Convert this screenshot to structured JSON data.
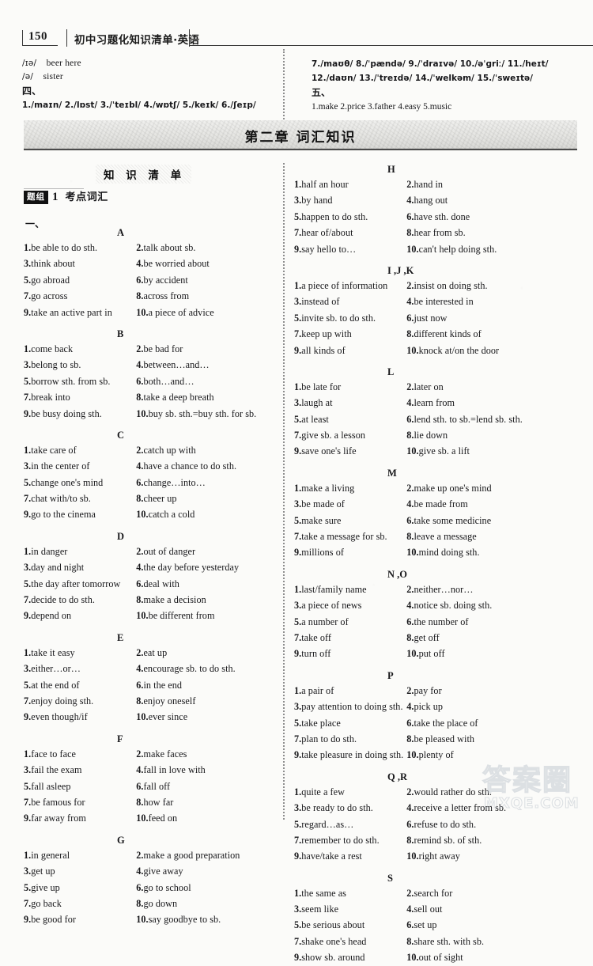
{
  "header": {
    "page_number": "150",
    "book_title": "初中习题化知识清单·英语"
  },
  "top_answers": {
    "left": {
      "ipa_lines": [
        {
          "symbol": "/ɪə/",
          "words": "beer   here"
        },
        {
          "symbol": "/ə/",
          "words": "sister"
        }
      ],
      "section_label": "四、",
      "answers": "1./maɪn/   2./lɒst/   3./ˈteɪbl/   4./wɒtʃ/   5./keɪk/   6./ʃeɪp/"
    },
    "right": {
      "line1": "7./maʊθ/    8./ˈpændə/    9./ˈdraɪvə/    10./əˈɡriː/    11./heɪt/",
      "line2": "12./daʊn/    13./ˈtreɪdə/    14./ˈwelkəm/    15./ˈsweɪtə/",
      "section_label": "五、",
      "answers": "1.make   2.price   3.father   4.easy   5.music"
    }
  },
  "chapter_banner": "第二章  词汇知识",
  "knowledge_list_title": "知 识 清 单",
  "question_group": {
    "badge": "题组",
    "number": "1",
    "label": "考点词汇",
    "sub_label": "一、"
  },
  "watermark": {
    "chinese": "答案圈",
    "english": "MXQE.COM"
  },
  "left_column": [
    {
      "letter": "A",
      "rows": [
        [
          "1.be able to do sth.",
          "2.talk about sb."
        ],
        [
          "3.think about",
          "4.be worried about"
        ],
        [
          "5.go abroad",
          "6.by accident"
        ],
        [
          "7.go across",
          "8.across from"
        ],
        [
          "9.take an active part in",
          "10.a piece of advice"
        ]
      ]
    },
    {
      "letter": "B",
      "rows": [
        [
          "1.come back",
          "2.be bad for"
        ],
        [
          "3.belong to sb.",
          "4.between…and…"
        ],
        [
          "5.borrow sth. from sb.",
          "6.both…and…"
        ],
        [
          "7.break into",
          "8.take a deep breath"
        ],
        [
          "9.be busy doing sth.",
          "10.buy sb. sth.=buy sth. for sb."
        ]
      ]
    },
    {
      "letter": "C",
      "rows": [
        [
          "1.take care of",
          "2.catch up with"
        ],
        [
          "3.in the center of",
          "4.have a chance to do sth."
        ],
        [
          "5.change one's mind",
          "6.change…into…"
        ],
        [
          "7.chat with/to sb.",
          "8.cheer up"
        ],
        [
          "9.go to the cinema",
          "10.catch a cold"
        ]
      ]
    },
    {
      "letter": "D",
      "rows": [
        [
          "1.in danger",
          "2.out of danger"
        ],
        [
          "3.day and night",
          "4.the day before yesterday"
        ],
        [
          "5.the day after tomorrow",
          "6.deal with"
        ],
        [
          "7.decide to do sth.",
          "8.make a decision"
        ],
        [
          "9.depend on",
          "10.be different from"
        ]
      ]
    },
    {
      "letter": "E",
      "rows": [
        [
          "1.take it easy",
          "2.eat up"
        ],
        [
          "3.either…or…",
          "4.encourage sb. to do sth."
        ],
        [
          "5.at the end of",
          "6.in the end"
        ],
        [
          "7.enjoy doing sth.",
          "8.enjoy oneself"
        ],
        [
          "9.even though/if",
          "10.ever since"
        ]
      ]
    },
    {
      "letter": "F",
      "rows": [
        [
          "1.face to face",
          "2.make faces"
        ],
        [
          "3.fail the exam",
          "4.fall in love with"
        ],
        [
          "5.fall asleep",
          "6.fall off"
        ],
        [
          "7.be famous for",
          "8.how far"
        ],
        [
          "9.far away from",
          "10.feed on"
        ]
      ]
    },
    {
      "letter": "G",
      "rows": [
        [
          "1.in general",
          "2.make a good preparation"
        ],
        [
          "3.get up",
          "4.give away"
        ],
        [
          "5.give up",
          "6.go to school"
        ],
        [
          "7.go back",
          "8.go down"
        ],
        [
          "9.be good for",
          "10.say goodbye to sb."
        ]
      ]
    }
  ],
  "right_column": [
    {
      "letter": "H",
      "rows": [
        [
          "1.half an hour",
          "2.hand in"
        ],
        [
          "3.by hand",
          "4.hang out"
        ],
        [
          "5.happen to do sth.",
          "6.have sth. done"
        ],
        [
          "7.hear of/about",
          "8.hear from sb."
        ],
        [
          "9.say hello to…",
          "10.can't help doing sth."
        ]
      ]
    },
    {
      "letter": "I ,J ,K",
      "rows": [
        [
          "1.a piece of information",
          "2.insist on doing sth."
        ],
        [
          "3.instead of",
          "4.be interested in"
        ],
        [
          "5.invite sb. to do sth.",
          "6.just now"
        ],
        [
          "7.keep up with",
          "8.different kinds of"
        ],
        [
          "9.all kinds of",
          "10.knock at/on the door"
        ]
      ]
    },
    {
      "letter": "L",
      "rows": [
        [
          "1.be late for",
          "2.later on"
        ],
        [
          "3.laugh at",
          "4.learn from"
        ],
        [
          "5.at least",
          "6.lend sth. to sb.=lend sb. sth."
        ],
        [
          "7.give sb. a lesson",
          "8.lie down"
        ],
        [
          "9.save one's life",
          "10.give sb. a lift"
        ]
      ]
    },
    {
      "letter": "M",
      "rows": [
        [
          "1.make a living",
          "2.make up one's mind"
        ],
        [
          "3.be made of",
          "4.be made from"
        ],
        [
          "5.make sure",
          "6.take some medicine"
        ],
        [
          "7.take a message for sb.",
          "8.leave a message"
        ],
        [
          "9.millions of",
          "10.mind doing sth."
        ]
      ]
    },
    {
      "letter": "N ,O",
      "rows": [
        [
          "1.last/family name",
          "2.neither…nor…"
        ],
        [
          "3.a piece of news",
          "4.notice sb. doing sth."
        ],
        [
          "5.a number of",
          "6.the number of"
        ],
        [
          "7.take off",
          "8.get off"
        ],
        [
          "9.turn off",
          "10.put off"
        ]
      ]
    },
    {
      "letter": "P",
      "rows": [
        [
          "1.a pair of",
          "2.pay for"
        ],
        [
          "3.pay attention to doing sth.",
          "4.pick up"
        ],
        [
          "5.take place",
          "6.take the place of"
        ],
        [
          "7.plan to do sth.",
          "8.be pleased with"
        ],
        [
          "9.take pleasure in doing sth.",
          "10.plenty of"
        ]
      ]
    },
    {
      "letter": "Q ,R",
      "rows": [
        [
          "1.quite a few",
          "2.would rather do sth."
        ],
        [
          "3.be ready to do sth.",
          "4.receive a letter from sb."
        ],
        [
          "5.regard…as…",
          "6.refuse to do sth."
        ],
        [
          "7.remember to do sth.",
          "8.remind sb. of sth."
        ],
        [
          "9.have/take a rest",
          "10.right away"
        ]
      ]
    },
    {
      "letter": "S",
      "rows": [
        [
          "1.the same as",
          "2.search for"
        ],
        [
          "3.seem like",
          "4.sell out"
        ],
        [
          "5.be serious about",
          "6.set up"
        ],
        [
          "7.shake one's head",
          "8.share sth. with sb."
        ],
        [
          "9.show sb. around",
          "10.out of sight"
        ]
      ]
    }
  ]
}
